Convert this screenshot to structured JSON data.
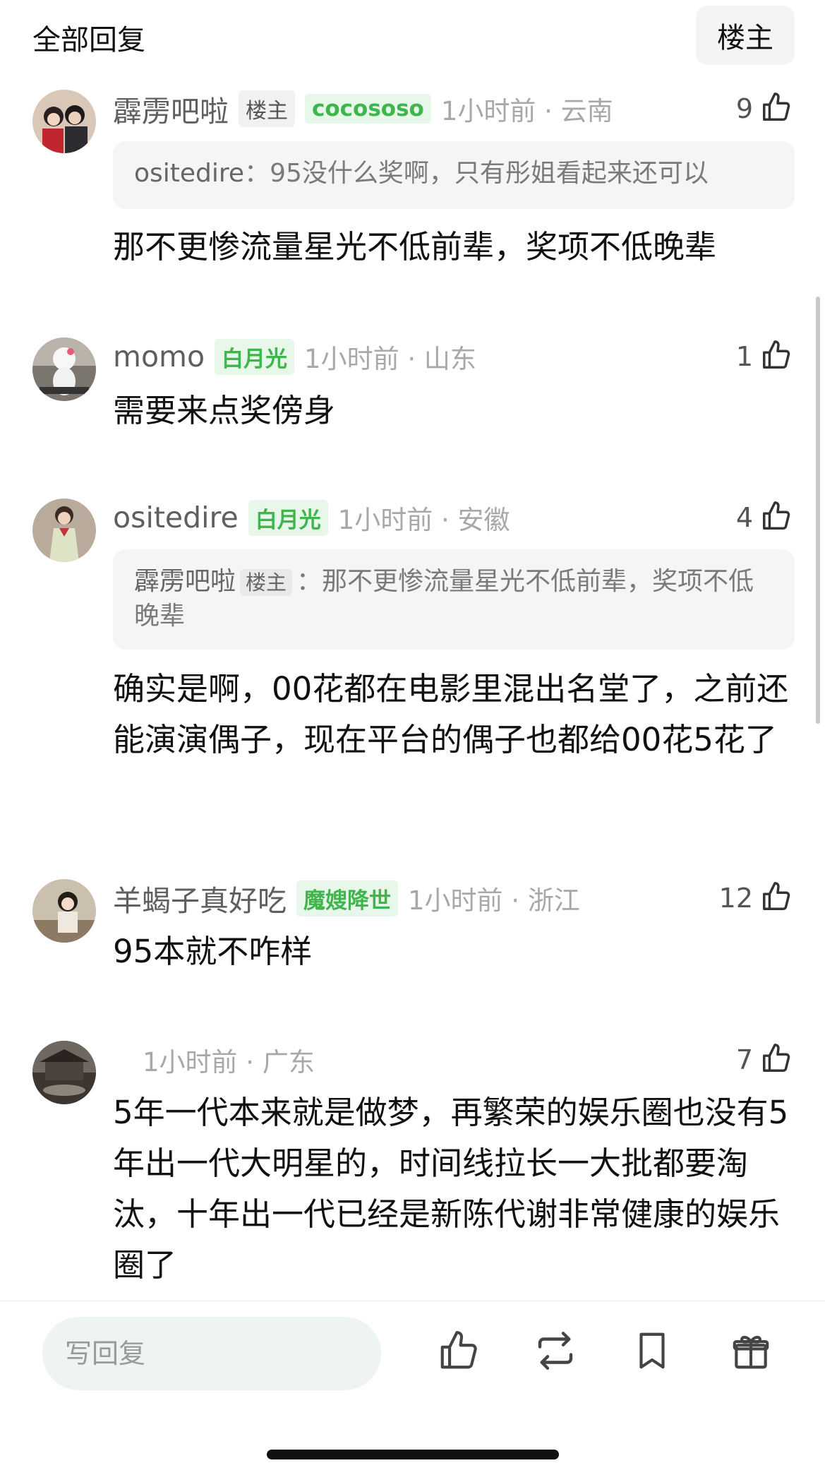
{
  "header": {
    "title": "全部回复",
    "op_button": "楼主"
  },
  "comments": [
    {
      "username": "霹雳吧啦",
      "op_badge": "楼主",
      "fan_badge": "cocososo",
      "time": "1小时前 · 云南",
      "likes": "9",
      "quote": {
        "user": "ositedire",
        "sep": "：",
        "text": "95没什么奖啊，只有彤姐看起来还可以"
      },
      "text": "那不更惨流量星光不低前辈，奖项不低晚辈"
    },
    {
      "username": "momo",
      "fan_badge": "白月光",
      "time": "1小时前 · 山东",
      "likes": "1",
      "text": "需要来点奖傍身"
    },
    {
      "username": "ositedire",
      "fan_badge": "白月光",
      "time": "1小时前 · 安徽",
      "likes": "4",
      "quote": {
        "user": "霹雳吧啦",
        "badge": "楼主",
        "sep": "：",
        "text": "那不更惨流量星光不低前辈，奖项不低晚辈"
      },
      "text": "确实是啊，00花都在电影里混出名堂了，之前还能演演偶子，现在平台的偶子也都给00花5花了"
    },
    {
      "username": "羊蝎子真好吃",
      "fan_badge": "魔嫂降世",
      "time": "1小时前 · 浙江",
      "likes": "12",
      "text": "95本就不咋样"
    },
    {
      "username": "",
      "time": "1小时前 · 广东",
      "likes": "7",
      "text": "5年一代本来就是做梦，再繁荣的娱乐圈也没有5年出一代大明星的，时间线拉长一大批都要淘汰，十年出一代已经是新陈代谢非常健康的娱乐圈了"
    }
  ],
  "bottom_bar": {
    "reply_placeholder": "写回复"
  },
  "colors": {
    "accent_green": "#3fb54d",
    "badge_green_bg": "#e7f7e9",
    "quote_bg": "#f5f5f5",
    "input_bg": "#eef4f0"
  },
  "icons": [
    "thumb-up-icon",
    "repost-icon",
    "bookmark-icon",
    "gift-icon"
  ]
}
